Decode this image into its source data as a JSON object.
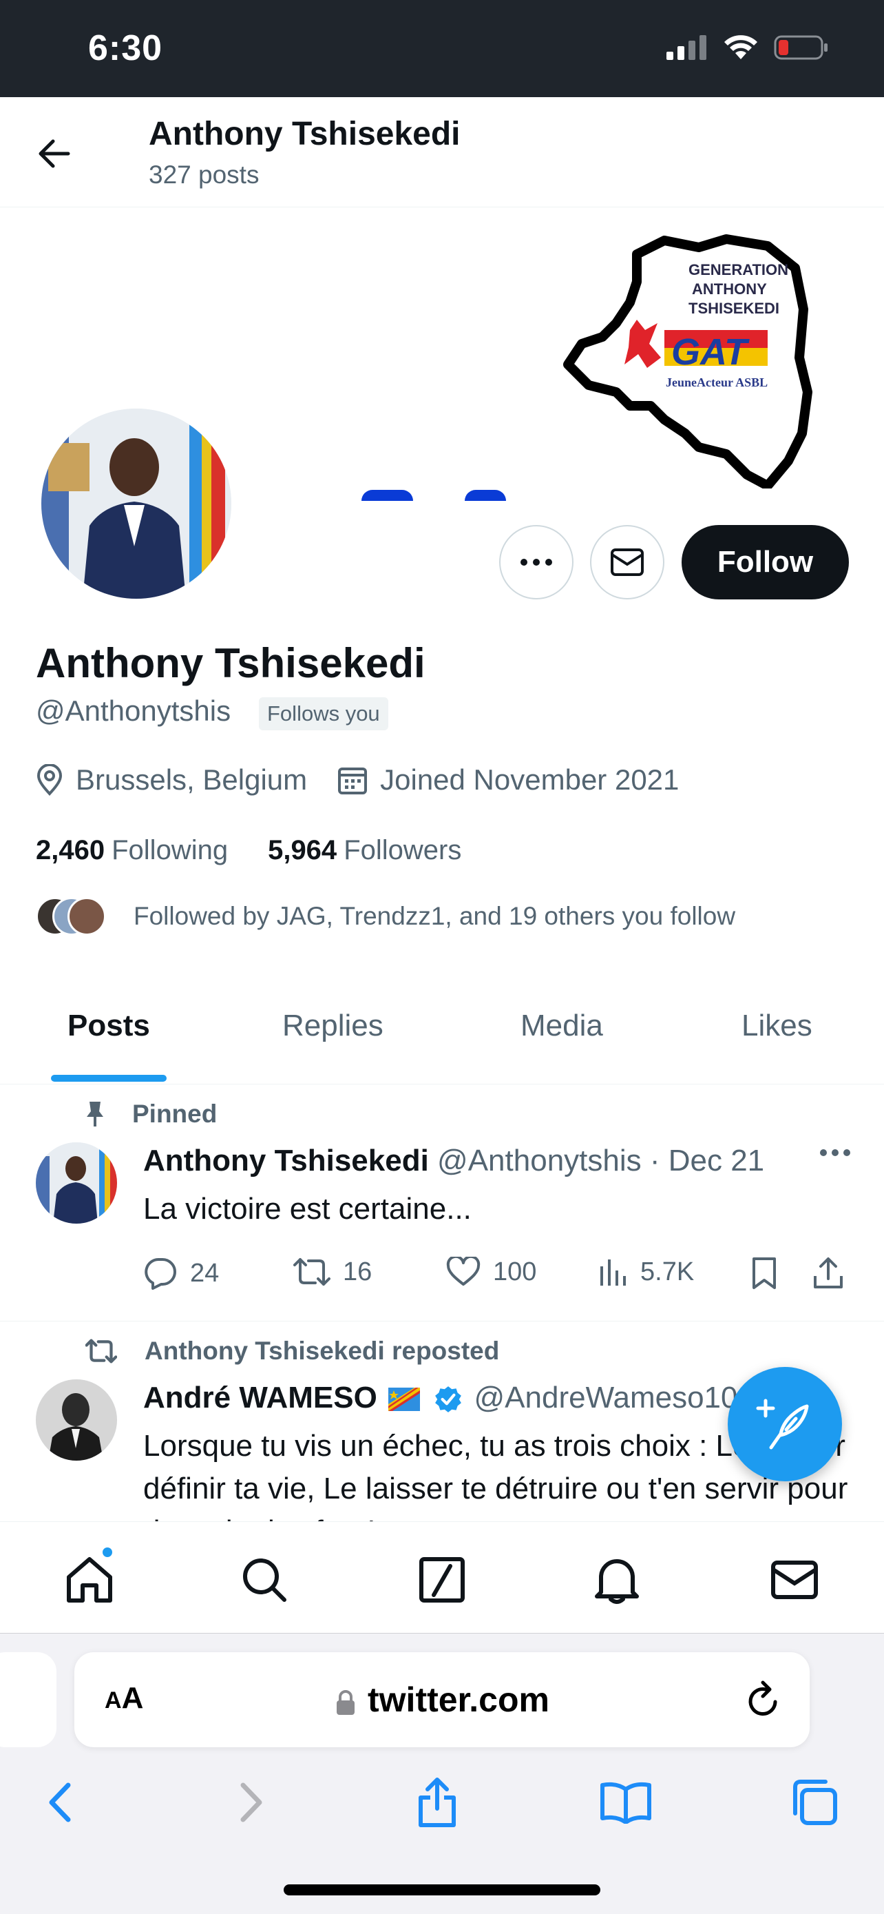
{
  "status": {
    "time": "6:30"
  },
  "header": {
    "title": "Anthony Tshisekedi",
    "posts": "327 posts"
  },
  "banner": {
    "logo_line1": "GENERATION",
    "logo_line2": "ANTHONY",
    "logo_line3": "TSHISEKEDI",
    "logo_gat": "GAT",
    "logo_sub": "JeuneActeur ASBL"
  },
  "profile": {
    "name": "Anthony Tshisekedi",
    "handle": "@Anthonytshis",
    "follows_you": "Follows you",
    "location": "Brussels, Belgium",
    "joined": "Joined November 2021",
    "following_count": "2,460",
    "following_label": "Following",
    "followers_count": "5,964",
    "followers_label": "Followers",
    "followed_by": "Followed by JAG, Trendzz1, and 19 others you follow"
  },
  "buttons": {
    "follow": "Follow"
  },
  "tabs": [
    {
      "label": "Posts",
      "active": true
    },
    {
      "label": "Replies"
    },
    {
      "label": "Media"
    },
    {
      "label": "Likes"
    }
  ],
  "tweets": [
    {
      "context": "Pinned",
      "name": "Anthony Tshisekedi",
      "handle_date": "@Anthonytshis · Dec 21",
      "text": "La victoire est certaine...",
      "replies": "24",
      "reposts": "16",
      "likes": "100",
      "views": "5.7K"
    },
    {
      "context": "Anthony Tshisekedi reposted",
      "name": "André WAMESO",
      "handle": "@AndreWameso10",
      "text": "Lorsque tu vis un échec, tu as trois choix : Le laisser définir ta vie, Le laisser te détruire ou t'en servir pour devenir plus fort !"
    }
  ],
  "browser": {
    "aa_big": "A",
    "aa_small": "A",
    "url": "twitter.com"
  },
  "colors": {
    "accent": "#1d9bf0",
    "text": "#0f1419",
    "secondary": "#536471",
    "statusbar": "#1f252c"
  }
}
